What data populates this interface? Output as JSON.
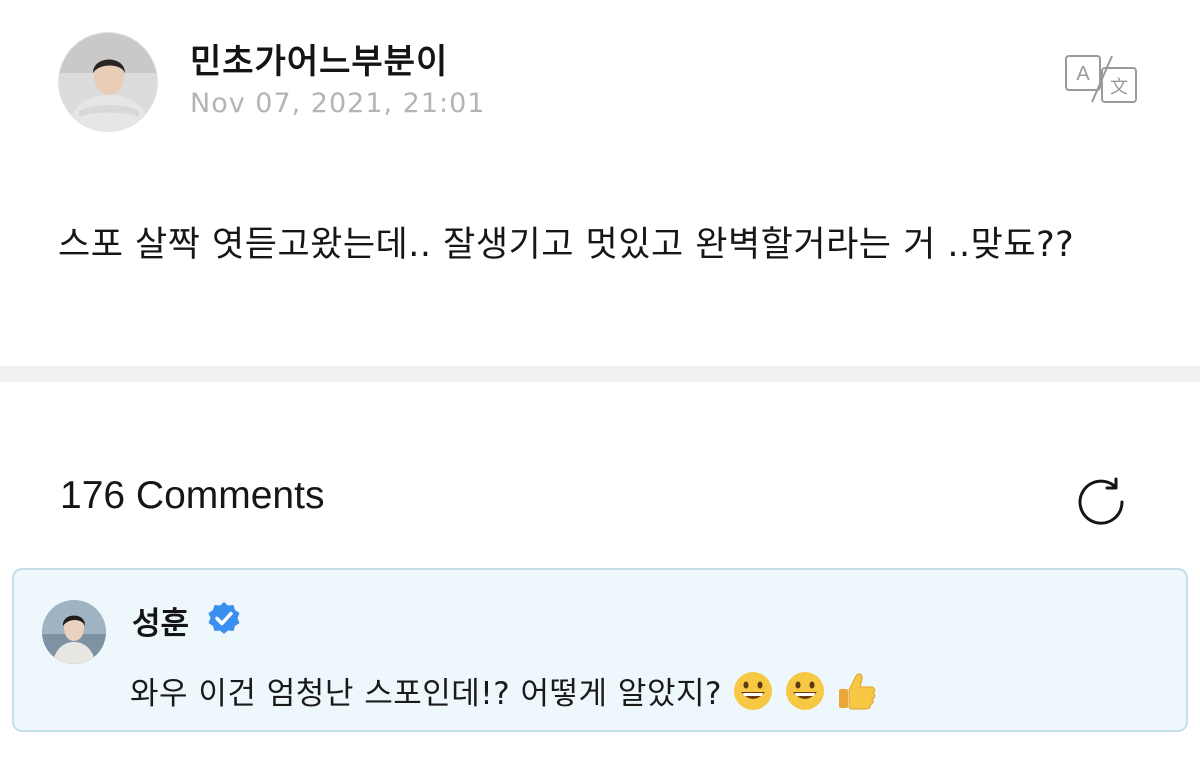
{
  "post": {
    "author_name": "민초가어느부분이",
    "date": "Nov 07, 2021, 21:01",
    "body": "스포 살짝 엿듣고왔는데.. 잘생기고 멋있고 완벽할거라는 거 ..맞됴??",
    "translate_icon": "translate-icon"
  },
  "comments": {
    "count_label": "176 Comments",
    "refresh_icon": "refresh-icon",
    "items": [
      {
        "name": "성훈",
        "verified": true,
        "text": "와우 이건 엄청난 스포인데!? 어떻게 알았지?",
        "emojis": [
          "grinning-face-emoji",
          "grinning-face-emoji",
          "thumbs-up-emoji"
        ]
      }
    ]
  },
  "colors": {
    "card_background": "#eef8fc",
    "card_border": "#c5dfea",
    "verified_blue": "#3a8ff0",
    "date_gray": "#b4b4b4"
  }
}
